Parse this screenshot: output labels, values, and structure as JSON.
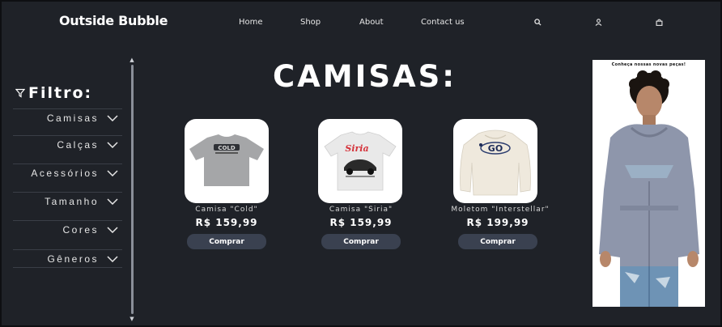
{
  "header": {
    "logo": "Outside Bubble",
    "nav": [
      "Home",
      "Shop",
      "About",
      "Contact us"
    ],
    "icons": [
      "search-icon",
      "user-icon",
      "bag-icon"
    ]
  },
  "sidebar": {
    "title": "Filtro:",
    "items": [
      {
        "label": "Camisas"
      },
      {
        "label": "Calças"
      },
      {
        "label": "Acessórios"
      },
      {
        "label": "Tamanho"
      },
      {
        "label": "Cores"
      },
      {
        "label": "Gêneros"
      }
    ]
  },
  "main": {
    "title": "CAMISAS:",
    "products": [
      {
        "name": "Camisa \"Cold\"",
        "price": "R$ 159,99",
        "button": "Comprar",
        "graphic": "COLD"
      },
      {
        "name": "Camisa \"Siria\"",
        "price": "R$ 159,99",
        "button": "Comprar",
        "graphic": "Siria"
      },
      {
        "name": "Moletom \"Interstellar\"",
        "price": "R$ 199,99",
        "button": "Comprar",
        "graphic": "GO"
      }
    ]
  },
  "promo": {
    "caption": "Conheça nossas novas peças!"
  },
  "colors": {
    "background": "#1f2228",
    "button": "#3a4150",
    "card": "#ffffff"
  }
}
